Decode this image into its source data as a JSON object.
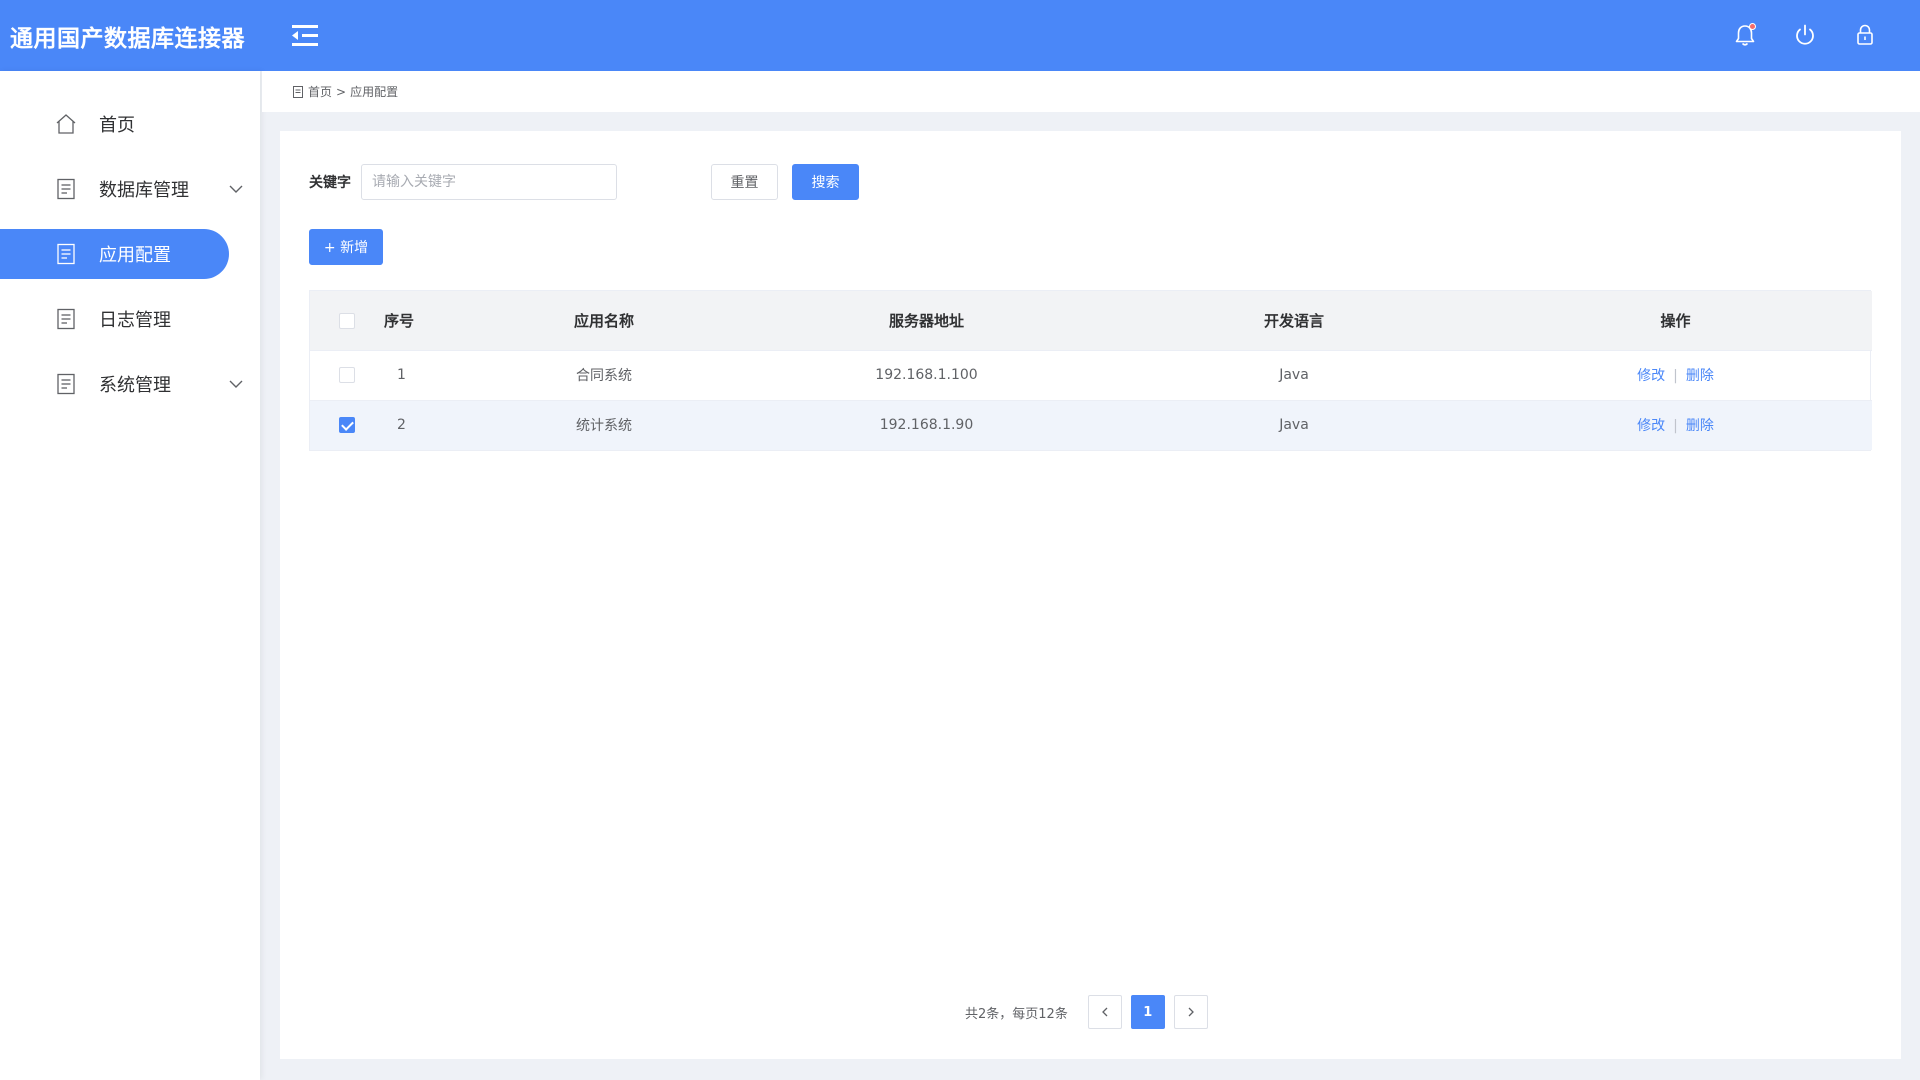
{
  "header": {
    "app_title": "通用国产数据库连接器"
  },
  "sidebar": {
    "items": [
      {
        "label": "首页"
      },
      {
        "label": "数据库管理"
      },
      {
        "label": "应用配置"
      },
      {
        "label": "日志管理"
      },
      {
        "label": "系统管理"
      }
    ]
  },
  "breadcrumb": {
    "home": "首页",
    "sep": ">",
    "current": "应用配置"
  },
  "filter": {
    "label": "关键字",
    "placeholder": "请输入关键字",
    "value": "",
    "reset_label": "重置",
    "search_label": "搜索"
  },
  "toolbar": {
    "add_label": "+ 新增"
  },
  "table": {
    "columns": [
      "序号",
      "应用名称",
      "服务器地址",
      "开发语言",
      "操作"
    ],
    "rows": [
      {
        "index": "1",
        "name": "合同系统",
        "address": "192.168.1.100",
        "language": "Java",
        "edit": "修改",
        "delete": "删除",
        "selected": false
      },
      {
        "index": "2",
        "name": "统计系统",
        "address": "192.168.1.90",
        "language": "Java",
        "edit": "修改",
        "delete": "删除",
        "selected": true
      }
    ],
    "op_sep": "|"
  },
  "pagination": {
    "total_text": "共2条，每页12条",
    "current_page": "1"
  },
  "colors": {
    "primary": "#4a87f8",
    "background": "#eef1f6"
  }
}
